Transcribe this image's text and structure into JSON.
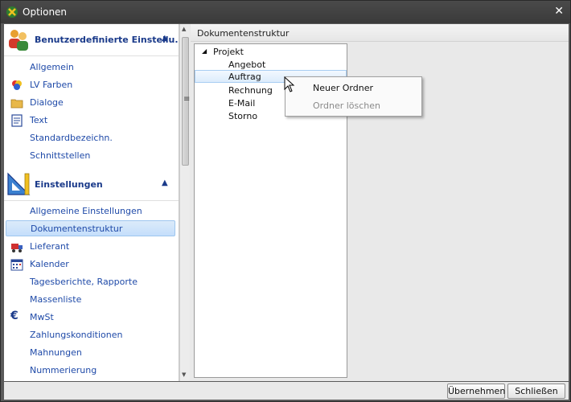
{
  "window": {
    "title": "Optionen",
    "close_glyph": "✕",
    "app_icon": "app-logo-icon"
  },
  "nav": {
    "groups": [
      {
        "label": "Benutzerdefinierte Einstellu...",
        "icon": "users-icon",
        "chevron": "▲",
        "items": [
          {
            "label": "Allgemein",
            "icon": ""
          },
          {
            "label": "LV Farben",
            "icon": "color-palette-icon"
          },
          {
            "label": "Dialoge",
            "icon": "folder-icon"
          },
          {
            "label": "Text",
            "icon": "text-document-icon"
          },
          {
            "label": "Standardbezeichn.",
            "icon": ""
          },
          {
            "label": "Schnittstellen",
            "icon": ""
          }
        ]
      },
      {
        "label": "Einstellungen",
        "icon": "triangle-ruler-icon",
        "chevron": "▲",
        "items": [
          {
            "label": "Allgemeine Einstellungen",
            "icon": ""
          },
          {
            "label": "Dokumentenstruktur",
            "icon": "",
            "selected": true
          },
          {
            "label": "Lieferant",
            "icon": "truck-icon"
          },
          {
            "label": "Kalender",
            "icon": "calendar-icon"
          },
          {
            "label": "Tagesberichte, Rapporte",
            "icon": ""
          },
          {
            "label": "Massenliste",
            "icon": ""
          },
          {
            "label": "MwSt",
            "icon": "euro-icon"
          },
          {
            "label": "Zahlungskonditionen",
            "icon": ""
          },
          {
            "label": "Mahnungen",
            "icon": ""
          },
          {
            "label": "Nummerierung",
            "icon": ""
          }
        ]
      }
    ]
  },
  "content": {
    "header": "Dokumentenstruktur",
    "tree": {
      "root": {
        "label": "Projekt",
        "expander": "◢"
      },
      "children": [
        {
          "label": "Angebot"
        },
        {
          "label": "Auftrag",
          "selected": true
        },
        {
          "label": "Rechnung"
        },
        {
          "label": "E-Mail"
        },
        {
          "label": "Storno"
        }
      ]
    }
  },
  "context_menu": {
    "items": [
      {
        "label": "Neuer Ordner",
        "enabled": true
      },
      {
        "label": "Ordner löschen",
        "enabled": false
      }
    ]
  },
  "footer": {
    "apply_label": "Übernehmen",
    "close_label": "Schließen"
  },
  "colors": {
    "link_blue": "#1f4aa8",
    "group_header_blue": "#1a3a8a",
    "selection_fill": "#c4defb",
    "title_bar": "#3a3a3a"
  }
}
